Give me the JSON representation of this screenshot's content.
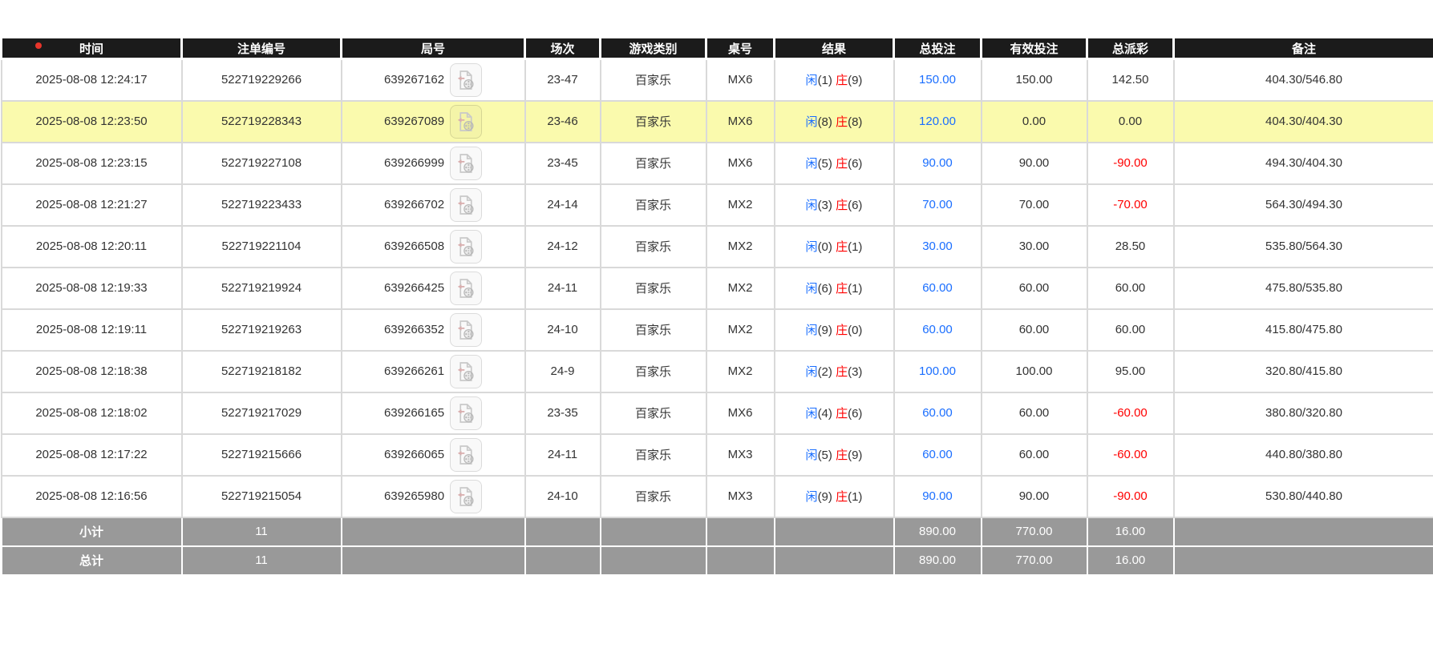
{
  "indicator": {
    "red_dot": true
  },
  "colors": {
    "header-bg": "#1b1b1b",
    "row-highlight": "#fafaad",
    "blue": "#1a6eff",
    "red": "#ff0000",
    "summary-bg": "#999999",
    "border": "#d9d9d9",
    "text": "#333333",
    "red-dot": "#e8352b"
  },
  "icons": {
    "round_replay": "video-file-icon"
  },
  "table": {
    "columns": [
      "时间",
      "注单编号",
      "局号",
      "场次",
      "游戏类别",
      "桌号",
      "结果",
      "总投注",
      "有效投注",
      "总派彩",
      "备注"
    ],
    "rows": [
      {
        "time": "2025-08-08 12:24:17",
        "order": "522719229266",
        "round": "639267162",
        "session": "23-47",
        "game": "百家乐",
        "table": "MX6",
        "player_label": "闲",
        "player_score": "(1)",
        "banker_label": "庄",
        "banker_score": "(9)",
        "bet": "150.00",
        "valid": "150.00",
        "payout": "142.50",
        "remark": "404.30/546.80",
        "highlight": false
      },
      {
        "time": "2025-08-08 12:23:50",
        "order": "522719228343",
        "round": "639267089",
        "session": "23-46",
        "game": "百家乐",
        "table": "MX6",
        "player_label": "闲",
        "player_score": "(8)",
        "banker_label": "庄",
        "banker_score": "(8)",
        "bet": "120.00",
        "valid": "0.00",
        "payout": "0.00",
        "remark": "404.30/404.30",
        "highlight": true
      },
      {
        "time": "2025-08-08 12:23:15",
        "order": "522719227108",
        "round": "639266999",
        "session": "23-45",
        "game": "百家乐",
        "table": "MX6",
        "player_label": "闲",
        "player_score": "(5)",
        "banker_label": "庄",
        "banker_score": "(6)",
        "bet": "90.00",
        "valid": "90.00",
        "payout": "-90.00",
        "remark": "494.30/404.30",
        "highlight": false
      },
      {
        "time": "2025-08-08 12:21:27",
        "order": "522719223433",
        "round": "639266702",
        "session": "24-14",
        "game": "百家乐",
        "table": "MX2",
        "player_label": "闲",
        "player_score": "(3)",
        "banker_label": "庄",
        "banker_score": "(6)",
        "bet": "70.00",
        "valid": "70.00",
        "payout": "-70.00",
        "remark": "564.30/494.30",
        "highlight": false
      },
      {
        "time": "2025-08-08 12:20:11",
        "order": "522719221104",
        "round": "639266508",
        "session": "24-12",
        "game": "百家乐",
        "table": "MX2",
        "player_label": "闲",
        "player_score": "(0)",
        "banker_label": "庄",
        "banker_score": "(1)",
        "bet": "30.00",
        "valid": "30.00",
        "payout": "28.50",
        "remark": "535.80/564.30",
        "highlight": false
      },
      {
        "time": "2025-08-08 12:19:33",
        "order": "522719219924",
        "round": "639266425",
        "session": "24-11",
        "game": "百家乐",
        "table": "MX2",
        "player_label": "闲",
        "player_score": "(6)",
        "banker_label": "庄",
        "banker_score": "(1)",
        "bet": "60.00",
        "valid": "60.00",
        "payout": "60.00",
        "remark": "475.80/535.80",
        "highlight": false
      },
      {
        "time": "2025-08-08 12:19:11",
        "order": "522719219263",
        "round": "639266352",
        "session": "24-10",
        "game": "百家乐",
        "table": "MX2",
        "player_label": "闲",
        "player_score": "(9)",
        "banker_label": "庄",
        "banker_score": "(0)",
        "bet": "60.00",
        "valid": "60.00",
        "payout": "60.00",
        "remark": "415.80/475.80",
        "highlight": false
      },
      {
        "time": "2025-08-08 12:18:38",
        "order": "522719218182",
        "round": "639266261",
        "session": "24-9",
        "game": "百家乐",
        "table": "MX2",
        "player_label": "闲",
        "player_score": "(2)",
        "banker_label": "庄",
        "banker_score": "(3)",
        "bet": "100.00",
        "valid": "100.00",
        "payout": "95.00",
        "remark": "320.80/415.80",
        "highlight": false
      },
      {
        "time": "2025-08-08 12:18:02",
        "order": "522719217029",
        "round": "639266165",
        "session": "23-35",
        "game": "百家乐",
        "table": "MX6",
        "player_label": "闲",
        "player_score": "(4)",
        "banker_label": "庄",
        "banker_score": "(6)",
        "bet": "60.00",
        "valid": "60.00",
        "payout": "-60.00",
        "remark": "380.80/320.80",
        "highlight": false
      },
      {
        "time": "2025-08-08 12:17:22",
        "order": "522719215666",
        "round": "639266065",
        "session": "24-11",
        "game": "百家乐",
        "table": "MX3",
        "player_label": "闲",
        "player_score": "(5)",
        "banker_label": "庄",
        "banker_score": "(9)",
        "bet": "60.00",
        "valid": "60.00",
        "payout": "-60.00",
        "remark": "440.80/380.80",
        "highlight": false
      },
      {
        "time": "2025-08-08 12:16:56",
        "order": "522719215054",
        "round": "639265980",
        "session": "24-10",
        "game": "百家乐",
        "table": "MX3",
        "player_label": "闲",
        "player_score": "(9)",
        "banker_label": "庄",
        "banker_score": "(1)",
        "bet": "90.00",
        "valid": "90.00",
        "payout": "-90.00",
        "remark": "530.80/440.80",
        "highlight": false
      }
    ],
    "subtotal": {
      "label": "小计",
      "count": "11",
      "bet": "890.00",
      "valid": "770.00",
      "payout": "16.00"
    },
    "total": {
      "label": "总计",
      "count": "11",
      "bet": "890.00",
      "valid": "770.00",
      "payout": "16.00"
    }
  }
}
